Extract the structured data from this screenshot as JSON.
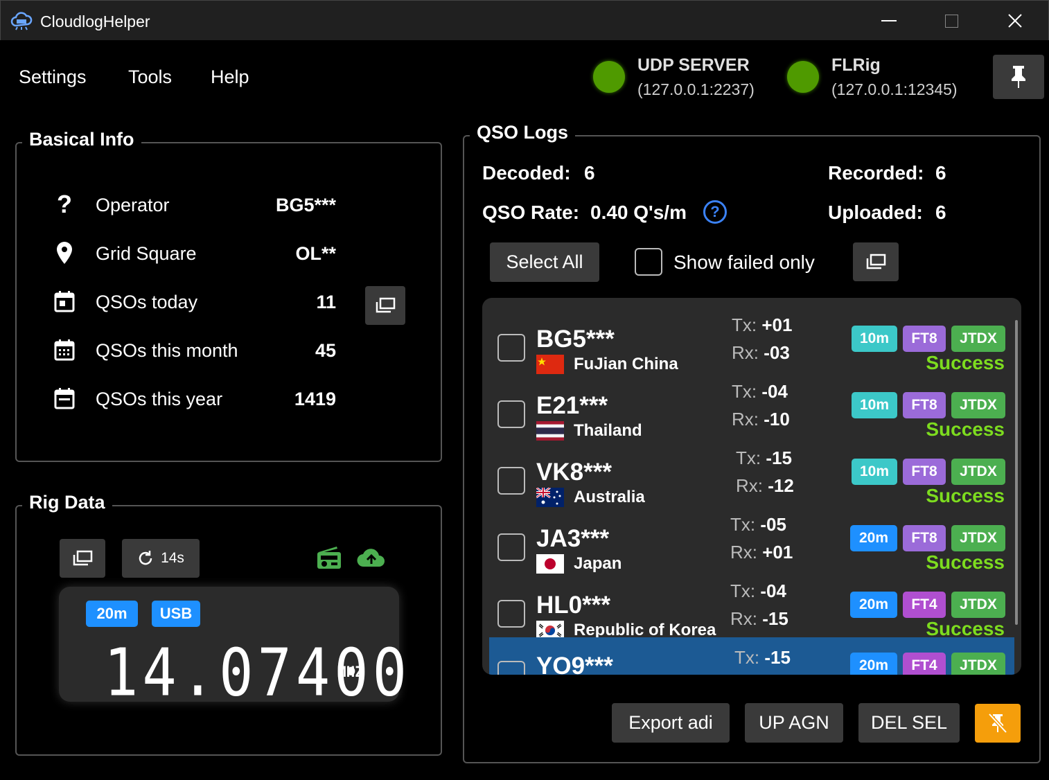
{
  "window": {
    "title": "CloudlogHelper"
  },
  "menu": {
    "items": [
      "Settings",
      "Tools",
      "Help"
    ]
  },
  "status": {
    "udp": {
      "title": "UDP SERVER",
      "address": "(127.0.0.1:2237)",
      "color": "#4f9a00"
    },
    "flrig": {
      "title": "FLRig",
      "address": "(127.0.0.1:12345)",
      "color": "#4f9a00"
    }
  },
  "basic_info": {
    "title": "Basical Info",
    "rows": [
      {
        "icon": "question-icon",
        "label": "Operator",
        "value": "BG5***"
      },
      {
        "icon": "location-pin-icon",
        "label": "Grid Square",
        "value": "OL**"
      },
      {
        "icon": "calendar-today-icon",
        "label": "QSOs today",
        "value": "11"
      },
      {
        "icon": "calendar-month-icon",
        "label": "QSOs this month",
        "value": "45"
      },
      {
        "icon": "calendar-year-icon",
        "label": "QSOs this year",
        "value": "1419"
      }
    ]
  },
  "rig_data": {
    "title": "Rig Data",
    "refresh_label": "14s",
    "band": "20m",
    "mode": "USB",
    "frequency": "14.07400",
    "unit": "MHZ",
    "accent": "#4caf50"
  },
  "qso_logs": {
    "title": "QSO Logs",
    "decoded_label": "Decoded:",
    "decoded": "6",
    "recorded_label": "Recorded:",
    "recorded": "6",
    "rate_label": "QSO Rate:",
    "rate": "0.40 Q's/m",
    "uploaded_label": "Uploaded:",
    "uploaded": "6",
    "select_all": "Select All",
    "show_failed": "Show failed only",
    "tx_label": "Tx:",
    "rx_label": "Rx:",
    "rows": [
      {
        "callsign": "BG5***",
        "country": "FuJian China",
        "flag": "cn",
        "tx": "+01",
        "rx": "-03",
        "band": "10m",
        "mode": "FT8",
        "client": "JTDX",
        "status": "Success"
      },
      {
        "callsign": "E21***",
        "country": "Thailand",
        "flag": "th",
        "tx": "-04",
        "rx": "-10",
        "band": "10m",
        "mode": "FT8",
        "client": "JTDX",
        "status": "Success"
      },
      {
        "callsign": "VK8***",
        "country": "Australia",
        "flag": "au",
        "tx": "-15",
        "rx": "-12",
        "band": "10m",
        "mode": "FT8",
        "client": "JTDX",
        "status": "Success"
      },
      {
        "callsign": "JA3***",
        "country": "Japan",
        "flag": "jp",
        "tx": "-05",
        "rx": "+01",
        "band": "20m",
        "mode": "FT8",
        "client": "JTDX",
        "status": "Success"
      },
      {
        "callsign": "HL0***",
        "country": "Republic of Korea",
        "flag": "kr",
        "tx": "-04",
        "rx": "-15",
        "band": "20m",
        "mode": "FT4",
        "client": "JTDX",
        "status": "Success"
      },
      {
        "callsign": "YO9***",
        "country": "",
        "flag": "",
        "tx": "-15",
        "rx": "",
        "band": "20m",
        "mode": "FT4",
        "client": "JTDX",
        "status": ""
      }
    ],
    "export": "Export adi",
    "upload_again": "UP AGN",
    "delete_selected": "DEL SEL"
  },
  "colors": {
    "band_10m": "#3cc8c8",
    "band_20m": "#1e90ff",
    "ft8": "#9b6bd9",
    "ft4": "#b04fd0",
    "jtdx": "#4caf50",
    "success": "#7ddc1f",
    "selected_row": "#1c5a94",
    "warn": "#f59e0b"
  }
}
